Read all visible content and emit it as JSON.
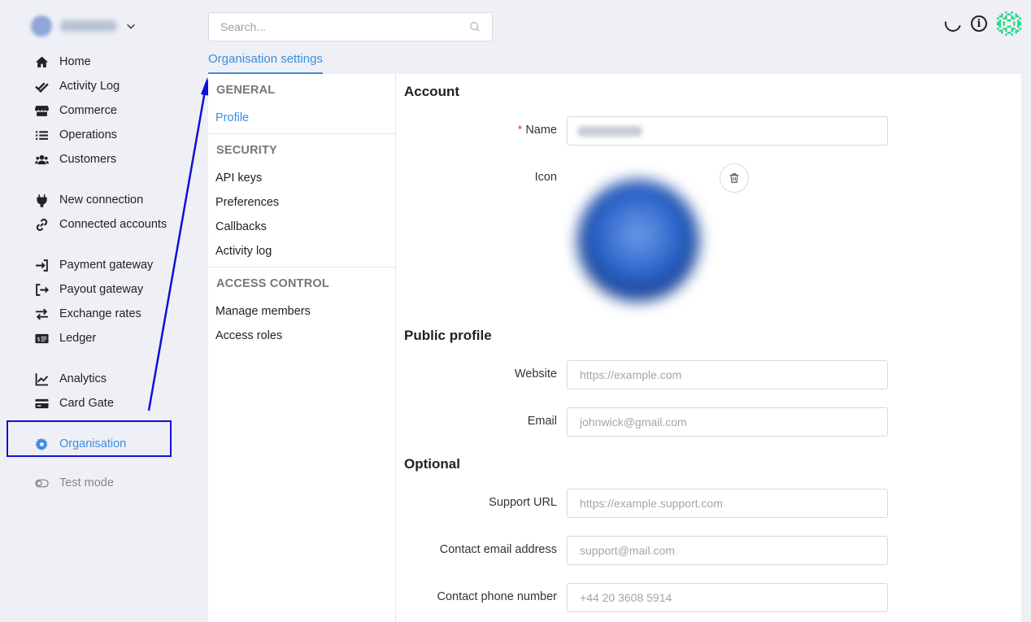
{
  "nav": {
    "items": [
      {
        "label": "Home",
        "icon": "home-icon"
      },
      {
        "label": "Activity Log",
        "icon": "double-check-icon"
      },
      {
        "label": "Commerce",
        "icon": "store-icon"
      },
      {
        "label": "Operations",
        "icon": "list-icon"
      },
      {
        "label": "Customers",
        "icon": "users-icon"
      },
      {
        "label": "New connection",
        "icon": "plug-icon"
      },
      {
        "label": "Connected accounts",
        "icon": "link-icon"
      },
      {
        "label": "Payment gateway",
        "icon": "sign-in-icon"
      },
      {
        "label": "Payout gateway",
        "icon": "sign-out-icon"
      },
      {
        "label": "Exchange rates",
        "icon": "exchange-icon"
      },
      {
        "label": "Ledger",
        "icon": "money-bill-icon"
      },
      {
        "label": "Analytics",
        "icon": "chart-line-icon"
      },
      {
        "label": "Card Gate",
        "icon": "credit-card-icon"
      },
      {
        "label": "Organisation",
        "icon": "gear-icon"
      },
      {
        "label": "Test mode",
        "icon": "toggle-icon"
      }
    ]
  },
  "search": {
    "placeholder": "Search..."
  },
  "tab": {
    "label": "Organisation settings"
  },
  "subnav": {
    "general": "GENERAL",
    "profile": "Profile",
    "security": "SECURITY",
    "api_keys": "API keys",
    "preferences": "Preferences",
    "callbacks": "Callbacks",
    "activity_log": "Activity log",
    "access_control": "ACCESS CONTROL",
    "manage_members": "Manage members",
    "access_roles": "Access roles"
  },
  "form": {
    "account_heading": "Account",
    "required_mark": "*",
    "name_label": "Name",
    "icon_label": "Icon",
    "public_heading": "Public profile",
    "website_label": "Website",
    "website_placeholder": "https://example.com",
    "email_label": "Email",
    "email_placeholder": "johnwick@gmail.com",
    "optional_heading": "Optional",
    "support_label": "Support URL",
    "support_placeholder": "https://example.support.com",
    "contact_email_label": "Contact email address",
    "contact_email_placeholder": "support@mail.com",
    "contact_phone_label": "Contact phone number",
    "contact_phone_placeholder": "+44 20 3608 5914"
  },
  "colors": {
    "accent": "#3a8ee0",
    "annotation": "#1010d8",
    "required": "#e74c3c"
  }
}
